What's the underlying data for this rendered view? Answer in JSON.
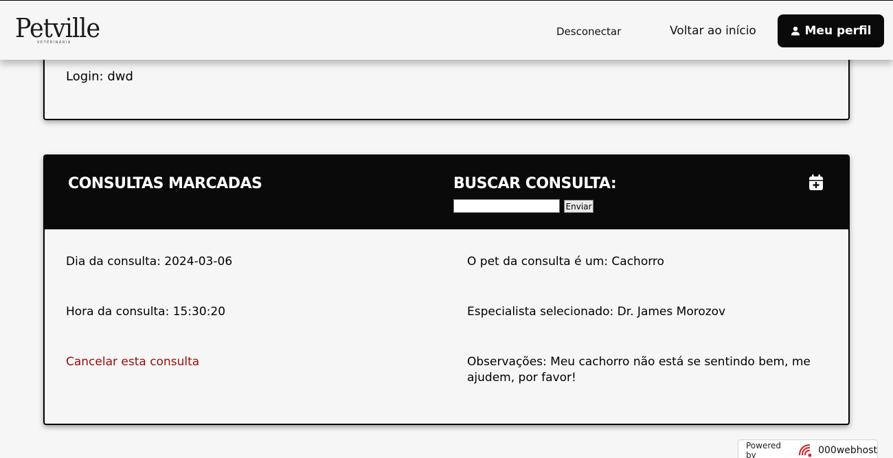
{
  "header": {
    "logo_text": "Petville",
    "logo_subtitle": "VETERINÁRIA",
    "nav": {
      "disconnect": "Desconectar",
      "home": "Voltar ao início",
      "profile": "Meu perfil"
    }
  },
  "account": {
    "login_label": "Login: dwd"
  },
  "appointments": {
    "title": "CONSULTAS MARCADAS",
    "search_title": "BUSCAR CONSULTA:",
    "search_value": "",
    "search_button": "Enviar",
    "item": {
      "day": "Dia da consulta: 2024-03-06",
      "pet": "O pet da consulta é um: Cachorro",
      "hour": "Hora da consulta: 15:30:20",
      "specialist": "Especialista selecionado: Dr. James Morozov",
      "cancel": "Cancelar esta consulta",
      "notes": "Observações: Meu cachorro não está se sentindo bem, me ajudem, por favor!"
    }
  },
  "footer": {
    "powered_by": "Powered by",
    "host": "000webhost"
  },
  "colors": {
    "header_bg": "#0a0a0a",
    "page_bg": "#f6f6f6",
    "cancel_link": "#9b0a0a"
  },
  "icons": [
    "user-icon",
    "calendar-plus-icon",
    "webhost-logo-icon"
  ]
}
